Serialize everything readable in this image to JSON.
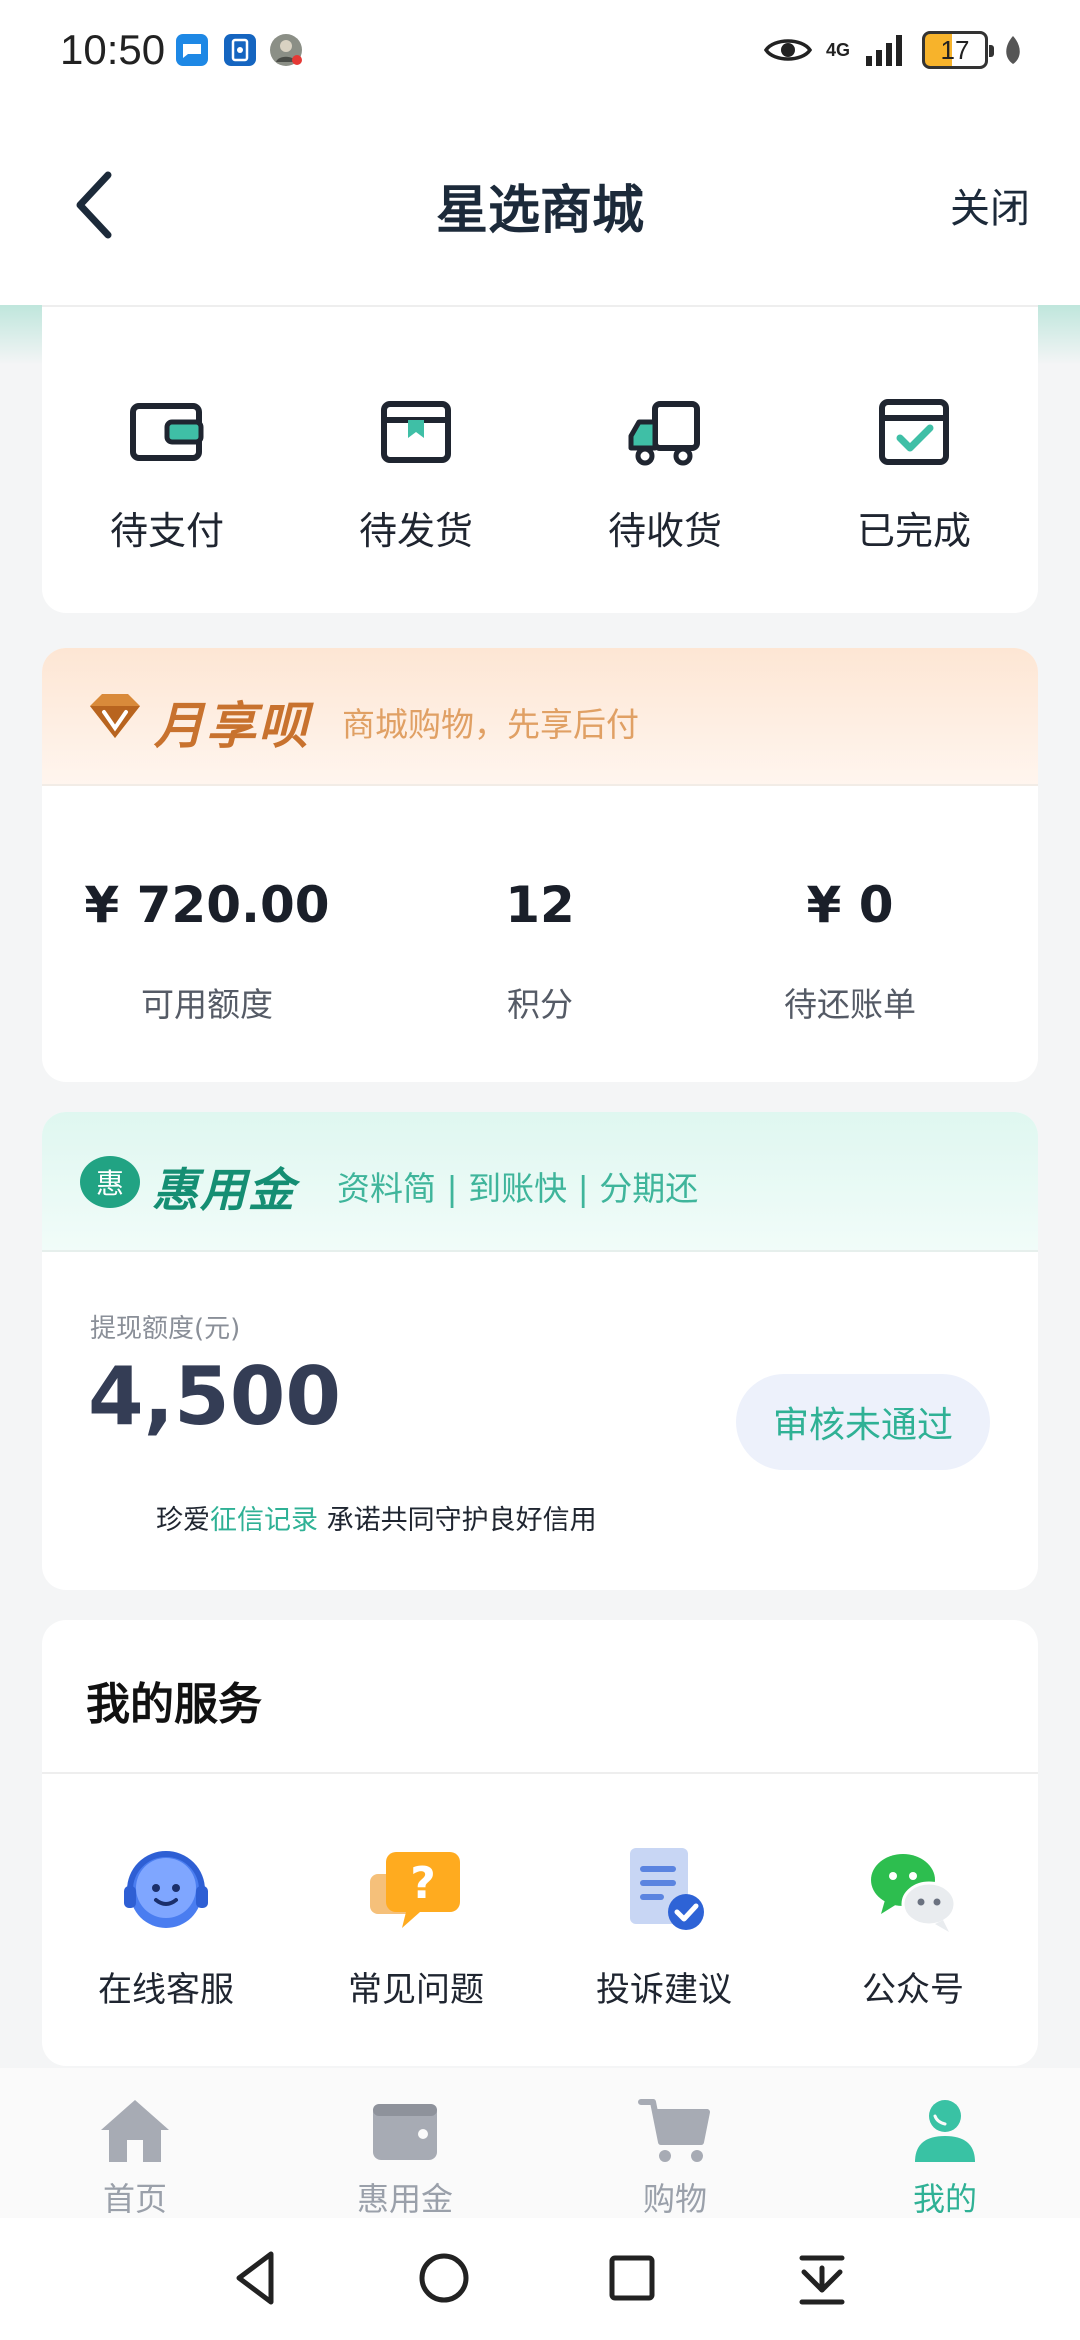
{
  "status_bar": {
    "time": "10:50",
    "network": "4G",
    "battery": "17"
  },
  "header": {
    "title": "星选商城",
    "close_label": "关闭"
  },
  "orders": [
    {
      "label": "待支付",
      "icon": "wallet-icon"
    },
    {
      "label": "待发货",
      "icon": "package-icon"
    },
    {
      "label": "待收货",
      "icon": "truck-icon"
    },
    {
      "label": "已完成",
      "icon": "completed-icon"
    }
  ],
  "yuexiangbei": {
    "brand": "月享呗",
    "slogan": "商城购物，先享后付",
    "stats": [
      {
        "value": "¥ 720.00",
        "label": "可用额度"
      },
      {
        "value": "12",
        "label": "积分"
      },
      {
        "value": "¥ 0",
        "label": "待还账单"
      }
    ]
  },
  "huiyongjin": {
    "brand": "惠用金",
    "logo_char": "惠",
    "slogan": "资料简 | 到账快 | 分期还",
    "limit_label": "提现额度(元)",
    "limit_value": "4,500",
    "review_status": "审核未通过",
    "note_prefix": "珍爱",
    "note_link": "征信记录",
    "note_suffix": " 承诺共同守护良好信用"
  },
  "services": {
    "title": "我的服务",
    "items": [
      {
        "label": "在线客服",
        "icon": "customer-service-icon"
      },
      {
        "label": "常见问题",
        "icon": "faq-icon"
      },
      {
        "label": "投诉建议",
        "icon": "complaint-icon"
      },
      {
        "label": "公众号",
        "icon": "wechat-icon"
      }
    ]
  },
  "tabs": [
    {
      "label": "首页",
      "icon": "home-icon",
      "active": false
    },
    {
      "label": "惠用金",
      "icon": "wallet-icon",
      "active": false
    },
    {
      "label": "购物",
      "icon": "cart-icon",
      "active": false
    },
    {
      "label": "我的",
      "icon": "profile-icon",
      "active": true
    }
  ],
  "colors": {
    "accent": "#2fb195",
    "yue_brand": "#c8722e",
    "hui_brand": "#158e73",
    "title": "#1c2a3a"
  }
}
